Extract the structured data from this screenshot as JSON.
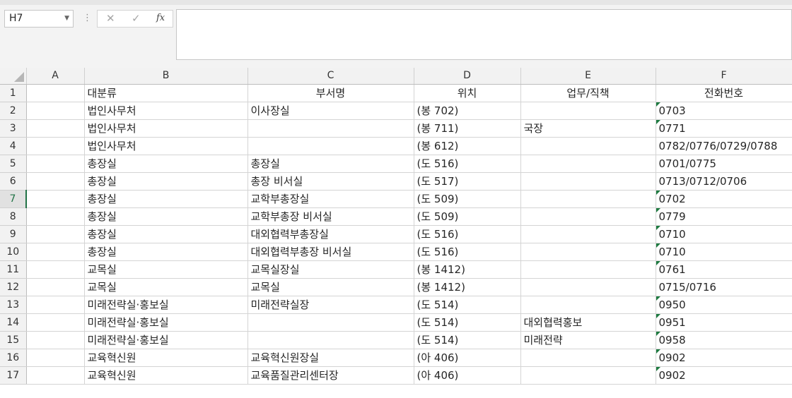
{
  "name_box": {
    "value": "H7"
  },
  "formula_bar": {
    "cancel_glyph": "✕",
    "enter_glyph": "✓",
    "function_glyph": "fx",
    "value": ""
  },
  "columns": [
    "A",
    "B",
    "C",
    "D",
    "E",
    "F"
  ],
  "selected_row": 7,
  "colors": {
    "accent": "#217346",
    "error_indicator": "#1d7a40"
  },
  "rows": [
    {
      "num": "1",
      "cells": [
        "",
        "대분류",
        "부서명",
        "위치",
        "업무/직책",
        "전화번호"
      ],
      "header": true
    },
    {
      "num": "2",
      "cells": [
        "",
        "법인사무처",
        "이사장실",
        "(봉 702)",
        "",
        "0703"
      ],
      "flag": true
    },
    {
      "num": "3",
      "cells": [
        "",
        "법인사무처",
        "",
        "(봉 711)",
        "국장",
        "0771"
      ],
      "flag": true
    },
    {
      "num": "4",
      "cells": [
        "",
        "법인사무처",
        "",
        "(봉 612)",
        "",
        "0782/0776/0729/0788"
      ],
      "flag": false
    },
    {
      "num": "5",
      "cells": [
        "",
        "총장실",
        "총장실",
        "(도 516)",
        "",
        "0701/0775"
      ],
      "flag": false
    },
    {
      "num": "6",
      "cells": [
        "",
        "총장실",
        "총장 비서실",
        "(도 517)",
        "",
        "0713/0712/0706"
      ],
      "flag": false
    },
    {
      "num": "7",
      "cells": [
        "",
        "총장실",
        "교학부총장실",
        "(도 509)",
        "",
        "0702"
      ],
      "flag": true
    },
    {
      "num": "8",
      "cells": [
        "",
        "총장실",
        "교학부총장 비서실",
        "(도 509)",
        "",
        "0779"
      ],
      "flag": true
    },
    {
      "num": "9",
      "cells": [
        "",
        "총장실",
        "대외협력부총장실",
        "(도 516)",
        "",
        "0710"
      ],
      "flag": true
    },
    {
      "num": "10",
      "cells": [
        "",
        "총장실",
        "대외협력부총장 비서실",
        "(도 516)",
        "",
        "0710"
      ],
      "flag": true
    },
    {
      "num": "11",
      "cells": [
        "",
        "교목실",
        "교목실장실",
        "(봉 1412)",
        "",
        "0761"
      ],
      "flag": true
    },
    {
      "num": "12",
      "cells": [
        "",
        "교목실",
        "교목실",
        "(봉 1412)",
        "",
        "0715/0716"
      ],
      "flag": false
    },
    {
      "num": "13",
      "cells": [
        "",
        "미래전략실·홍보실",
        "미래전략실장",
        "(도 514)",
        "",
        "0950"
      ],
      "flag": true
    },
    {
      "num": "14",
      "cells": [
        "",
        "미래전략실·홍보실",
        "",
        "(도 514)",
        "대외협력홍보",
        "0951"
      ],
      "flag": true
    },
    {
      "num": "15",
      "cells": [
        "",
        "미래전략실·홍보실",
        "",
        "(도 514)",
        "미래전략",
        "0958"
      ],
      "flag": true
    },
    {
      "num": "16",
      "cells": [
        "",
        "교육혁신원",
        "교육혁신원장실",
        "(아 406)",
        "",
        "0902"
      ],
      "flag": true
    },
    {
      "num": "17",
      "cells": [
        "",
        "교육혁신원",
        "교육품질관리센터장",
        "(아 406)",
        "",
        "0902"
      ],
      "flag": true
    }
  ]
}
